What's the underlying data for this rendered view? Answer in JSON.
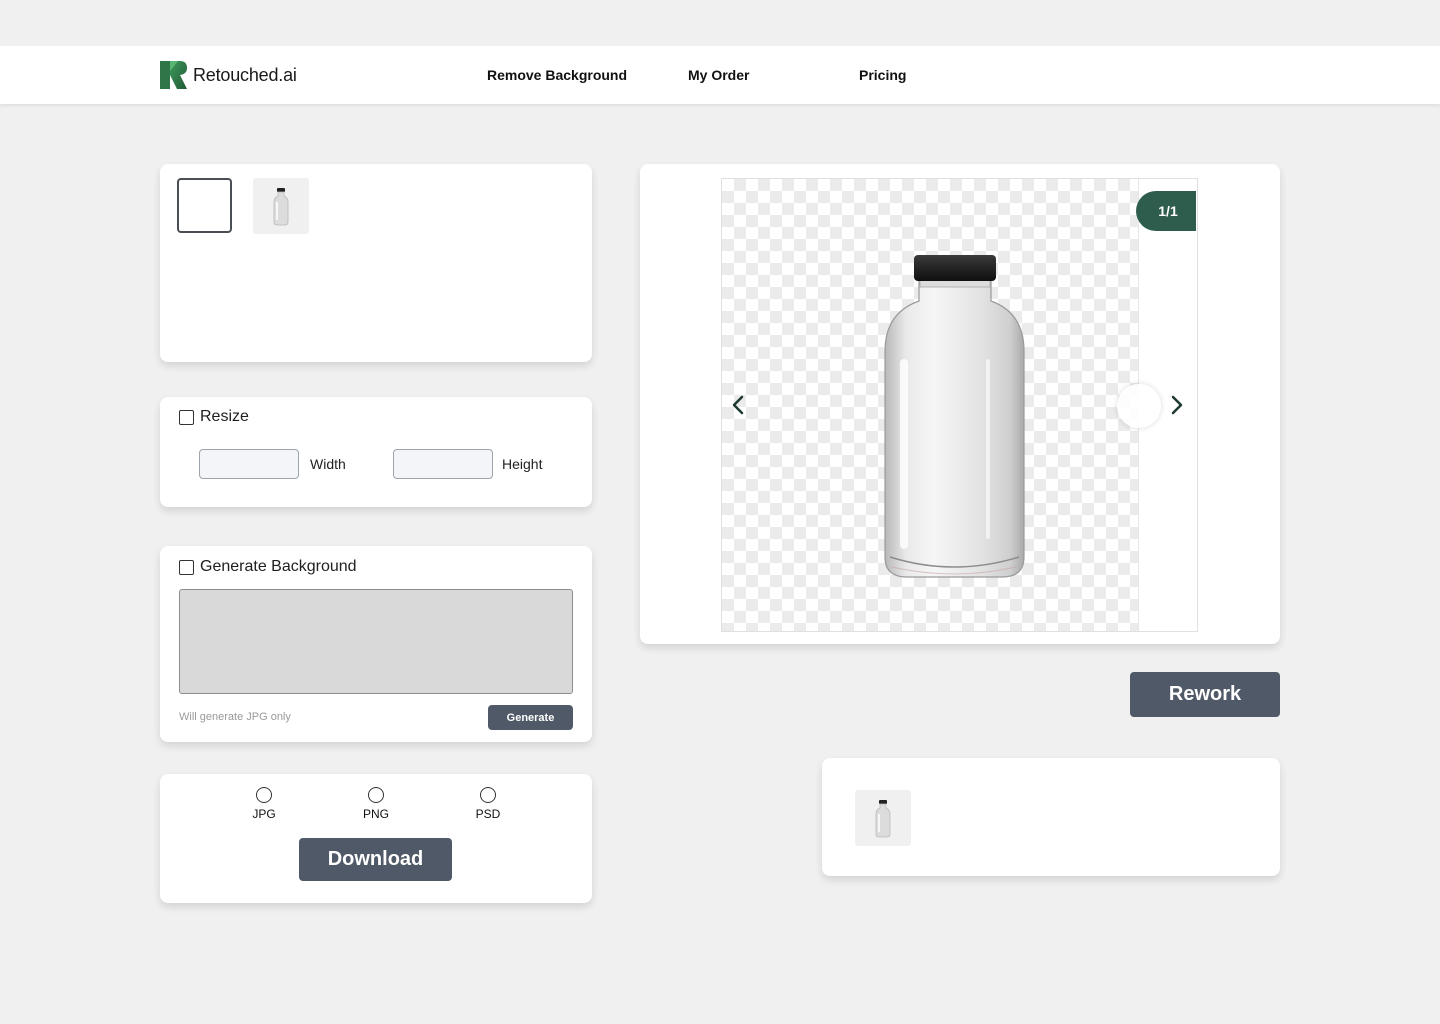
{
  "brand": {
    "name": "Retouched.ai",
    "color": "#2f7a4a"
  },
  "nav": {
    "remove_background": "Remove Background",
    "my_order": "My Order",
    "pricing": "Pricing"
  },
  "resize": {
    "label": "Resize",
    "checked": false,
    "width_label": "Width",
    "height_label": "Height",
    "width_value": "",
    "height_value": ""
  },
  "generate": {
    "label": "Generate Background",
    "checked": false,
    "prompt_value": "",
    "hint": "Will generate JPG only",
    "button": "Generate"
  },
  "download": {
    "formats": [
      "JPG",
      "PNG",
      "PSD"
    ],
    "button": "Download"
  },
  "viewer": {
    "counter": "1/1",
    "prev_icon": "chevron-left-icon",
    "next_icon": "chevron-right-icon"
  },
  "rework": {
    "button": "Rework"
  },
  "colors": {
    "accent_dark": "#4f5967",
    "counter_green": "#2f5d4d",
    "background": "#f0f0f0"
  }
}
